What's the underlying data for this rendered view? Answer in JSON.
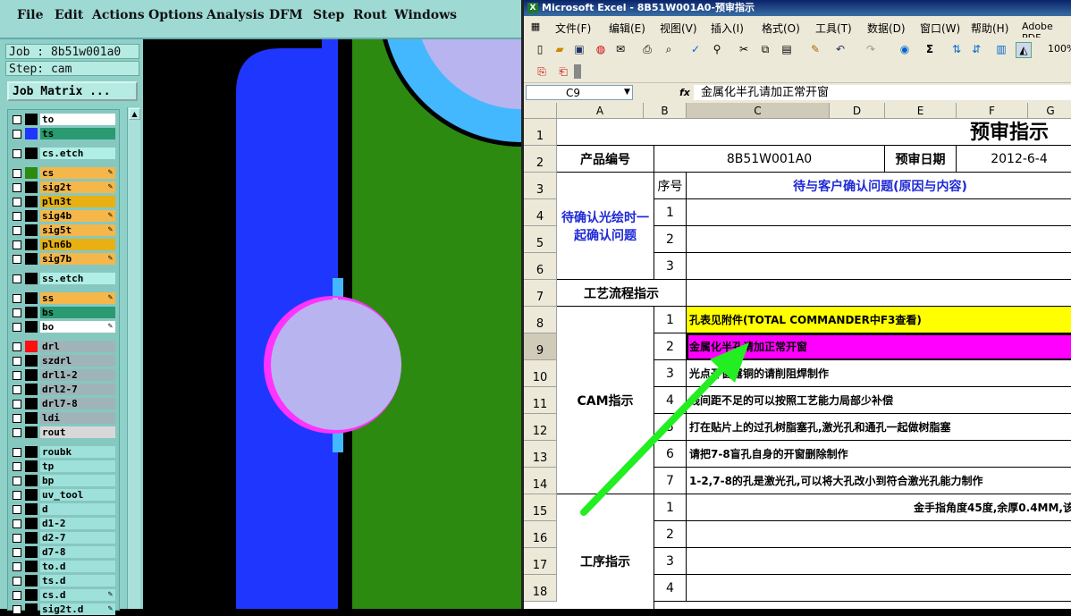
{
  "cam": {
    "menu": [
      "File",
      "Edit",
      "Actions",
      "Options",
      "Analysis",
      "DFM",
      "Step",
      "Rout",
      "Windows"
    ],
    "job_label": "Job : 8b51w001a0",
    "step_label": "Step: cam",
    "job_matrix_button": "Job Matrix ...",
    "layers": [
      {
        "name": "to",
        "color": "#ffffff",
        "swatch": "#000000",
        "edit": false
      },
      {
        "name": "ts",
        "color": "#2a9a70",
        "swatch": "#1f36ff",
        "edit": false
      },
      {
        "name": "cs.etch",
        "color": "#b0eee6",
        "swatch": "#000000",
        "edit": false
      },
      {
        "name": "cs",
        "color": "#f5b74a",
        "swatch": "#2d8a10",
        "edit": true
      },
      {
        "name": "sig2t",
        "color": "#f5b74a",
        "swatch": "#000000",
        "edit": true
      },
      {
        "name": "pln3t",
        "color": "#e8b012",
        "swatch": "#000000",
        "edit": false
      },
      {
        "name": "sig4b",
        "color": "#f5b74a",
        "swatch": "#000000",
        "edit": true
      },
      {
        "name": "sig5t",
        "color": "#f5b74a",
        "swatch": "#000000",
        "edit": true
      },
      {
        "name": "pln6b",
        "color": "#e8b012",
        "swatch": "#000000",
        "edit": false
      },
      {
        "name": "sig7b",
        "color": "#f5b74a",
        "swatch": "#000000",
        "edit": true
      },
      {
        "name": "ss.etch",
        "color": "#b0eee6",
        "swatch": "#000000",
        "edit": false
      },
      {
        "name": "ss",
        "color": "#f5b74a",
        "swatch": "#000000",
        "edit": true
      },
      {
        "name": "bs",
        "color": "#2a9a70",
        "swatch": "#000000",
        "edit": false
      },
      {
        "name": "bo",
        "color": "#ffffff",
        "swatch": "#000000",
        "edit": true
      },
      {
        "name": "drl",
        "color": "#9eb4b8",
        "swatch": "#ff1010",
        "edit": false
      },
      {
        "name": "szdrl",
        "color": "#9eb4b8",
        "swatch": "#000000",
        "edit": false
      },
      {
        "name": "drl1-2",
        "color": "#9eb4b8",
        "swatch": "#000000",
        "edit": false
      },
      {
        "name": "drl2-7",
        "color": "#9eb4b8",
        "swatch": "#000000",
        "edit": false
      },
      {
        "name": "drl7-8",
        "color": "#9eb4b8",
        "swatch": "#000000",
        "edit": false
      },
      {
        "name": "ldi",
        "color": "#9eb4b8",
        "swatch": "#000000",
        "edit": false
      },
      {
        "name": "rout",
        "color": "#d8d8d8",
        "swatch": "#000000",
        "edit": false
      },
      {
        "name": "roubk",
        "color": "#9ee0da",
        "swatch": "#000000",
        "edit": false
      },
      {
        "name": "tp",
        "color": "#9ee0da",
        "swatch": "#000000",
        "edit": false
      },
      {
        "name": "bp",
        "color": "#9ee0da",
        "swatch": "#000000",
        "edit": false
      },
      {
        "name": "uv_tool",
        "color": "#9ee0da",
        "swatch": "#000000",
        "edit": false
      },
      {
        "name": "d",
        "color": "#9ee0da",
        "swatch": "#000000",
        "edit": false
      },
      {
        "name": "d1-2",
        "color": "#9ee0da",
        "swatch": "#000000",
        "edit": false
      },
      {
        "name": "d2-7",
        "color": "#9ee0da",
        "swatch": "#000000",
        "edit": false
      },
      {
        "name": "d7-8",
        "color": "#9ee0da",
        "swatch": "#000000",
        "edit": false
      },
      {
        "name": "to.d",
        "color": "#9ee0da",
        "swatch": "#000000",
        "edit": false
      },
      {
        "name": "ts.d",
        "color": "#9ee0da",
        "swatch": "#000000",
        "edit": false
      },
      {
        "name": "cs.d",
        "color": "#9ee0da",
        "swatch": "#000000",
        "edit": true
      },
      {
        "name": "sig2t.d",
        "color": "#9ee0da",
        "swatch": "#000000",
        "edit": true
      }
    ],
    "canvas_colors": {
      "copper": "#1f36ff",
      "ground": "#2d8a10",
      "cyan": "#44b8ff",
      "lavender": "#b8b4f0",
      "magenta": "#ff33ff"
    }
  },
  "excel": {
    "title": "Microsoft Excel - 8B51W001A0-预审指示",
    "menu": [
      "文件(F)",
      "编辑(E)",
      "视图(V)",
      "插入(I)",
      "格式(O)",
      "工具(T)",
      "数据(D)",
      "窗口(W)",
      "帮助(H)",
      "Adobe PDF"
    ],
    "zoom": "100%",
    "name_box": "C9",
    "fx_label": "fx",
    "formula": "金属化半孔请加正常开窗",
    "columns": [
      "A",
      "B",
      "C",
      "D",
      "E",
      "F",
      "G"
    ],
    "rows": [
      "1",
      "2",
      "3",
      "4",
      "5",
      "6",
      "7",
      "8",
      "9",
      "10",
      "11",
      "12",
      "13",
      "14",
      "15",
      "16",
      "17",
      "18"
    ],
    "cells": {
      "title": "预审指示",
      "product_no_label": "产品编号",
      "product_no": "8B51W001A0",
      "review_date_label": "预审日期",
      "review_date": "2012-6-4",
      "confirm_group": "待确认光绘时一起确认问题",
      "seq_header": "序号",
      "issue_header": "待与客户确认问题(原因与内容)",
      "confirm_seq": [
        "1",
        "2",
        "3"
      ],
      "process_label": "工艺流程指示",
      "cam_label": "CAM指示",
      "cam_seq": [
        "1",
        "2",
        "3",
        "4",
        "5",
        "6",
        "7"
      ],
      "cam_items": [
        "孔表见附件(TOTAL COMMANDER中F3查看)",
        "金属化半孔请加正常开窗",
        "光点开窗露铜的请削阻焊制作",
        "线间距不足的可以按照工艺能力局部少补偿",
        "打在贴片上的过孔树脂塞孔,激光孔和通孔一起做树脂塞",
        "请把7-8盲孔自身的开窗删除制作",
        "1-2,7-8的孔是激光孔,可以将大孔改小到符合激光孔能力制作"
      ],
      "proc_label": "工序指示",
      "proc_seq": [
        "1",
        "2",
        "3",
        "4"
      ],
      "proc_item_1": "金手指角度45度,余厚0.4MM,该"
    },
    "highlight_colors": {
      "yellow": "#ffff00",
      "magenta": "#ff00ff"
    }
  },
  "annotation": {
    "arrow_color": "#22ee22"
  }
}
